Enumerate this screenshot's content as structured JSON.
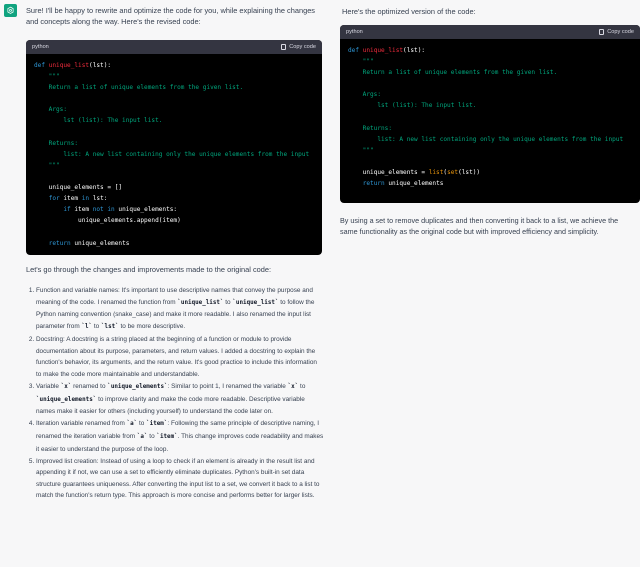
{
  "left": {
    "intro": "Sure! I'll be happy to rewrite and optimize the code for you, while explaining the changes and concepts along the way. Here's the revised code:",
    "code_lang": "python",
    "copy_label": "Copy code",
    "code_lines": [
      [
        {
          "t": "def ",
          "c": "kw"
        },
        {
          "t": "unique_list",
          "c": "fn"
        },
        {
          "t": "(lst):",
          "c": ""
        }
      ],
      [
        {
          "t": "    \"\"\"",
          "c": "str"
        }
      ],
      [
        {
          "t": "    Return a list of unique elements from the given list.",
          "c": "str"
        }
      ],
      [
        {
          "t": "",
          "c": ""
        }
      ],
      [
        {
          "t": "    Args:",
          "c": "str"
        }
      ],
      [
        {
          "t": "        lst (list): The input list.",
          "c": "str"
        }
      ],
      [
        {
          "t": "",
          "c": ""
        }
      ],
      [
        {
          "t": "    Returns:",
          "c": "str"
        }
      ],
      [
        {
          "t": "        list: A new list containing only the unique elements from the input",
          "c": "str"
        }
      ],
      [
        {
          "t": "    \"\"\"",
          "c": "str"
        }
      ],
      [
        {
          "t": "",
          "c": ""
        }
      ],
      [
        {
          "t": "    unique_elements = []",
          "c": ""
        }
      ],
      [
        {
          "t": "    ",
          "c": ""
        },
        {
          "t": "for",
          "c": "kw"
        },
        {
          "t": " item ",
          "c": ""
        },
        {
          "t": "in",
          "c": "kw"
        },
        {
          "t": " lst:",
          "c": ""
        }
      ],
      [
        {
          "t": "        ",
          "c": ""
        },
        {
          "t": "if",
          "c": "kw"
        },
        {
          "t": " item ",
          "c": ""
        },
        {
          "t": "not in",
          "c": "kw"
        },
        {
          "t": " unique_elements:",
          "c": ""
        }
      ],
      [
        {
          "t": "            unique_elements.append(item)",
          "c": ""
        }
      ],
      [
        {
          "t": "",
          "c": ""
        }
      ],
      [
        {
          "t": "    ",
          "c": ""
        },
        {
          "t": "return",
          "c": "kw"
        },
        {
          "t": " unique_elements",
          "c": ""
        }
      ]
    ],
    "subheading": "Let's go through the changes and improvements made to the original code:",
    "list": [
      [
        {
          "t": "Function and variable names: It's important to use descriptive names that convey the purpose and meaning of the code. I renamed the function from "
        },
        {
          "c": "`unique_list`"
        },
        {
          "t": " to "
        },
        {
          "c": "`unique_list`"
        },
        {
          "t": " to follow the Python naming convention (snake_case) and make it more readable. I also renamed the input list parameter from "
        },
        {
          "c": "`l`"
        },
        {
          "t": " to "
        },
        {
          "c": "`lst`"
        },
        {
          "t": " to be more descriptive."
        }
      ],
      [
        {
          "t": "Docstring: A docstring is a string placed at the beginning of a function or module to provide documentation about its purpose, parameters, and return values. I added a docstring to explain the function's behavior, its arguments, and the return value. It's good practice to include this information to make the code more maintainable and understandable."
        }
      ],
      [
        {
          "t": "Variable "
        },
        {
          "c": "`x`"
        },
        {
          "t": " renamed to "
        },
        {
          "c": "`unique_elements`"
        },
        {
          "t": ": Similar to point 1, I renamed the variable "
        },
        {
          "c": "`x`"
        },
        {
          "t": " to "
        },
        {
          "c": "`unique_elements`"
        },
        {
          "t": " to improve clarity and make the code more readable. Descriptive variable names make it easier for others (including yourself) to understand the code later on."
        }
      ],
      [
        {
          "t": "Iteration variable renamed from "
        },
        {
          "c": "`a`"
        },
        {
          "t": " to "
        },
        {
          "c": "`item`"
        },
        {
          "t": ": Following the same principle of descriptive naming, I renamed the iteration variable from "
        },
        {
          "c": "`a`"
        },
        {
          "t": " to "
        },
        {
          "c": "`item`"
        },
        {
          "t": ". This change improves code readability and makes it easier to understand the purpose of the loop."
        }
      ],
      [
        {
          "t": "Improved list creation: Instead of using a loop to check if an element is already in the result list and appending it if not, we can use a set to efficiently eliminate duplicates. Python's built-in set data structure guarantees uniqueness. After converting the input list to a set, we convert it back to a list to match the function's return type. This approach is more concise and performs better for larger lists."
        }
      ]
    ]
  },
  "right": {
    "intro": "Here's the optimized version of the code:",
    "code_lang": "python",
    "copy_label": "Copy code",
    "code_lines": [
      [
        {
          "t": "def ",
          "c": "kw"
        },
        {
          "t": "unique_list",
          "c": "fn"
        },
        {
          "t": "(lst):",
          "c": ""
        }
      ],
      [
        {
          "t": "    \"\"\"",
          "c": "str"
        }
      ],
      [
        {
          "t": "    Return a list of unique elements from the given list.",
          "c": "str"
        }
      ],
      [
        {
          "t": "",
          "c": ""
        }
      ],
      [
        {
          "t": "    Args:",
          "c": "str"
        }
      ],
      [
        {
          "t": "        lst (list): The input list.",
          "c": "str"
        }
      ],
      [
        {
          "t": "",
          "c": ""
        }
      ],
      [
        {
          "t": "    Returns:",
          "c": "str"
        }
      ],
      [
        {
          "t": "        list: A new list containing only the unique elements from the input",
          "c": "str"
        }
      ],
      [
        {
          "t": "    \"\"\"",
          "c": "str"
        }
      ],
      [
        {
          "t": "",
          "c": ""
        }
      ],
      [
        {
          "t": "    unique_elements = ",
          "c": ""
        },
        {
          "t": "list",
          "c": "bi"
        },
        {
          "t": "(",
          "c": ""
        },
        {
          "t": "set",
          "c": "bi"
        },
        {
          "t": "(lst))",
          "c": ""
        }
      ],
      [
        {
          "t": "    ",
          "c": ""
        },
        {
          "t": "return",
          "c": "kw"
        },
        {
          "t": " unique_elements",
          "c": ""
        }
      ]
    ],
    "outro": "By using a set to remove duplicates and then converting it back to a list, we achieve the same functionality as the original code but with improved efficiency and simplicity."
  },
  "colors": {
    "avatar": "#10a37f",
    "keyword": "#2e95d3",
    "function": "#f22c3d",
    "string": "#00a67d",
    "builtin": "#e9950c"
  },
  "icons": {
    "avatar": "openai-logo-icon",
    "copy": "copy-icon"
  }
}
